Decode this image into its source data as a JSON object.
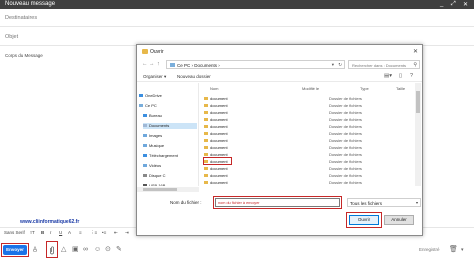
{
  "compose": {
    "title": "Nouveau message",
    "controls": [
      "_",
      "⤢",
      "✕"
    ],
    "to_placeholder": "Destinataires",
    "subject_placeholder": "Objet",
    "body_label": "Corps du Message",
    "site_url": "www.cliinformatique62.fr"
  },
  "format_bar": {
    "font": "Sans Serif",
    "size": "тT",
    "bold": "B",
    "italic": "I",
    "underline": "U",
    "color": "A",
    "align": "≡",
    "numbered": "⋮≡",
    "bulleted": "•≡",
    "indent_less": "⇤",
    "indent_more": "⇥",
    "quote": "❝",
    "strike": "S̶",
    "clear": "T̸"
  },
  "bottom_bar": {
    "send_label": "Envoyer",
    "saved_label": "Enregistré"
  },
  "dialog": {
    "title": "Ouvrir",
    "close": "✕",
    "address": "Ce PC  ›  Documents  ›",
    "search_placeholder": "Rechercher dans : Documents",
    "toolbar": {
      "organize": "Organiser ▾",
      "new_folder": "Nouveau dossier"
    },
    "nav_items": [
      {
        "label": "OneDrive",
        "indent": 0,
        "color": "#3b8fe0"
      },
      {
        "label": "Ce PC",
        "indent": 0,
        "color": "#7aaedb"
      },
      {
        "label": "Bureau",
        "indent": 1,
        "color": "#3b8fe0"
      },
      {
        "label": "Documents",
        "indent": 1,
        "color": "#9fb8d6"
      },
      {
        "label": "Images",
        "indent": 1,
        "color": "#6fa8dc"
      },
      {
        "label": "Musique",
        "indent": 1,
        "color": "#6fa8dc"
      },
      {
        "label": "Téléchargement",
        "indent": 1,
        "color": "#3b8fe0"
      },
      {
        "label": "Vidéos",
        "indent": 1,
        "color": "#6fa8dc"
      },
      {
        "label": "Disque C",
        "indent": 1,
        "color": "#888888"
      },
      {
        "label": "USB 16B",
        "indent": 1,
        "color": "#555555"
      }
    ],
    "columns": {
      "name": "Nom",
      "modified": "Modifié le",
      "type": "Type",
      "size": "Taille"
    },
    "files": [
      {
        "name": "document",
        "type": "Dossier de fichiers"
      },
      {
        "name": "document",
        "type": "Dossier de fichiers"
      },
      {
        "name": "document",
        "type": "Dossier de fichiers"
      },
      {
        "name": "document",
        "type": "Dossier de fichiers"
      },
      {
        "name": "document",
        "type": "Dossier de fichiers"
      },
      {
        "name": "document",
        "type": "Dossier de fichiers"
      },
      {
        "name": "document",
        "type": "Dossier de fichiers"
      },
      {
        "name": "document",
        "type": "Dossier de fichiers"
      },
      {
        "name": "document",
        "type": "Dossier de fichiers"
      },
      {
        "name": "document",
        "type": "Dossier de fichiers"
      },
      {
        "name": "document",
        "type": "Dossier de fichiers"
      },
      {
        "name": "document",
        "type": "Dossier de fichiers"
      },
      {
        "name": "document",
        "type": "Dossier de fichiers"
      }
    ],
    "filename_label": "Nom du fichier :",
    "filename_value": "nom du fichier à envoyer",
    "filetype_value": "Tous les fichiers",
    "open_label": "Ouvrir",
    "cancel_label": "Annuler"
  },
  "colors": {
    "highlight": "#c62828",
    "send": "#1a73e8",
    "selected_nav": "#cce4f7"
  }
}
